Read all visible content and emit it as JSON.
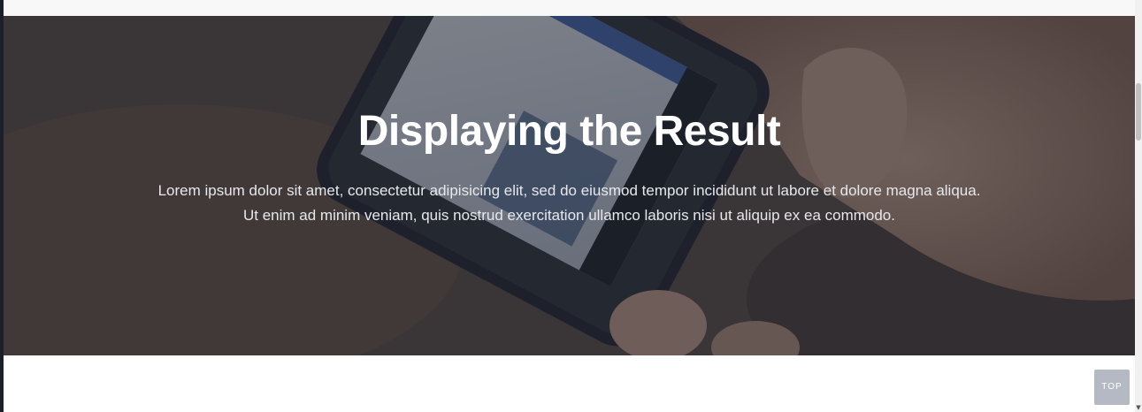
{
  "hero": {
    "title": "Displaying the Result",
    "text": "Lorem ipsum dolor sit amet, consectetur adipisicing elit, sed do eiusmod tempor incididunt ut labore et dolore magna aliqua. Ut enim ad minim veniam, quis nostrud exercitation ullamco laboris nisi ut aliquip ex ea commodo.",
    "background_image": "hand-holding-smartphone-photo",
    "overlay_color": "#1c202c"
  },
  "back_to_top": {
    "label": "TOP",
    "color": "#b4b9c3"
  },
  "scrollbar": {
    "down_arrow_icon": "chevron-down-icon"
  }
}
